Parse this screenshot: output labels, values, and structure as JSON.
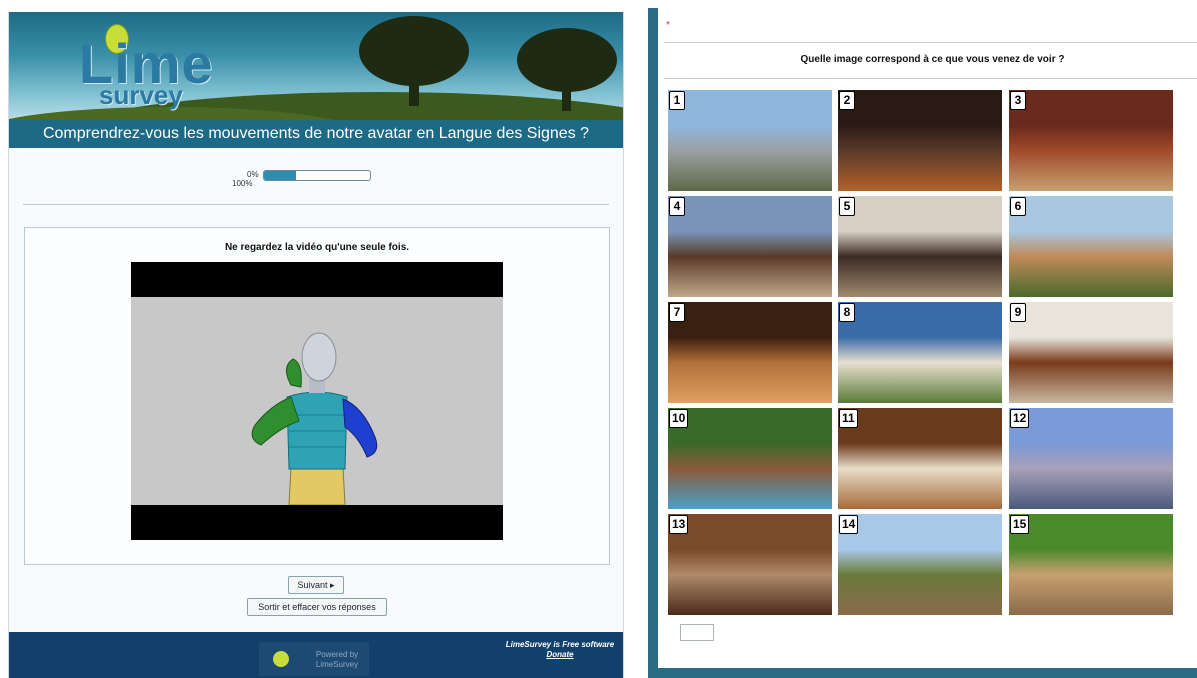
{
  "left": {
    "logo": {
      "line1": "Lime",
      "line2": "survey"
    },
    "survey_title": "Comprendrez-vous les mouvements de notre avatar en Langue des Signes ?",
    "progress": {
      "start_label": "0%",
      "end_label": "100%",
      "value": 0.3
    },
    "question_instruction": "Ne regardez la vidéo qu'une seule fois.",
    "next_button": "Suivant ▸",
    "exit_button": "Sortir et effacer vos réponses",
    "footer": {
      "powered_by": "Powered by",
      "powered_name": "LimeSurvey",
      "free_software": "LimeSurvey is Free software",
      "donate": "Donate"
    }
  },
  "right": {
    "required_marker": "*",
    "question": "Quelle image correspond à ce que vous venez de voir ?",
    "answer_value": "",
    "images": [
      {
        "number": "1",
        "subject": "city skyline avenue",
        "colors": [
          "#8fb6dc",
          "#9aa1a4",
          "#5d6a47"
        ]
      },
      {
        "number": "2",
        "subject": "living room sofa",
        "colors": [
          "#2a1a14",
          "#5a3a2a",
          "#b4622a"
        ]
      },
      {
        "number": "3",
        "subject": "wine shelf",
        "colors": [
          "#6a2a1c",
          "#a04a2a",
          "#c8a070"
        ]
      },
      {
        "number": "4",
        "subject": "city street buildings",
        "colors": [
          "#7a95b8",
          "#5a3a2a",
          "#c0a88a"
        ]
      },
      {
        "number": "5",
        "subject": "wine bottles rack",
        "colors": [
          "#d8d0c4",
          "#3a2a22",
          "#a08a70"
        ]
      },
      {
        "number": "6",
        "subject": "wooden cabin construction",
        "colors": [
          "#a8c8e0",
          "#c08a5a",
          "#4a6a2a"
        ]
      },
      {
        "number": "7",
        "subject": "wine cellar barrels",
        "colors": [
          "#3a2010",
          "#b0703a",
          "#e0a060"
        ]
      },
      {
        "number": "8",
        "subject": "pyramid tent house",
        "colors": [
          "#3a6aa8",
          "#e8e0d0",
          "#5a7a3a"
        ]
      },
      {
        "number": "9",
        "subject": "dining room chairs",
        "colors": [
          "#e8e4dc",
          "#7a3a1a",
          "#c8b8a0"
        ]
      },
      {
        "number": "10",
        "subject": "house on small island",
        "colors": [
          "#3a6a2a",
          "#8a5a3a",
          "#4aa0c8"
        ]
      },
      {
        "number": "11",
        "subject": "hotel bedroom",
        "colors": [
          "#6a3a1c",
          "#e8dcc8",
          "#a86a3a"
        ]
      },
      {
        "number": "12",
        "subject": "mosque with minarets",
        "colors": [
          "#7a9ad8",
          "#a8a0b8",
          "#4a5a7a"
        ]
      },
      {
        "number": "13",
        "subject": "stacked firewood logs",
        "colors": [
          "#7a4a2a",
          "#b08a6a",
          "#4a2a1a"
        ]
      },
      {
        "number": "14",
        "subject": "cleared forest field",
        "colors": [
          "#a8c8e8",
          "#6a7a3a",
          "#8a6a4a"
        ]
      },
      {
        "number": "15",
        "subject": "cut logs on grass",
        "colors": [
          "#4a8a2a",
          "#c8a070",
          "#8a6a4a"
        ]
      }
    ]
  }
}
